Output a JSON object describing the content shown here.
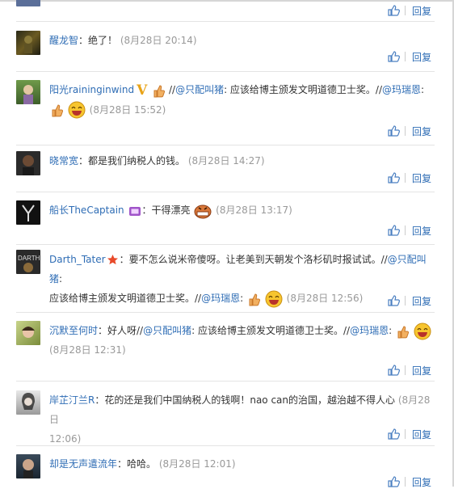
{
  "reply_label": "回复",
  "colors": {
    "link": "#2f6db5",
    "time": "#999999",
    "text": "#333333",
    "separator": "#e4e4e4"
  },
  "comments": [
    {
      "author": "醒龙智",
      "segments": [
        "：绝了！"
      ],
      "time": "(8月28日 20:14)"
    },
    {
      "author": "阳光raininginwind",
      "segments": [
        "//",
        "@只配叫猪",
        ": 应该给博主颁发文明道德卫士奖。//",
        "@玛瑞恩",
        ":"
      ],
      "time": "(8月28日 15:52)"
    },
    {
      "author": "晓常宽",
      "segments": [
        "：都是我们纳税人的钱。"
      ],
      "time": "(8月28日 14:27)"
    },
    {
      "author": "船长TheCaptain",
      "segments": [
        "：干得漂亮"
      ],
      "time": "(8月28日 13:17)"
    },
    {
      "author": "Darth_Tater",
      "segments": [
        "：要不怎么说米帝傻呀。让老美到天朝发个洛杉矶时报试试。//",
        "@只配叫猪",
        ":",
        "应该给博主颁发文明道德卫士奖。//",
        "@玛瑞恩",
        ":"
      ],
      "time": "(8月28日 12:56)"
    },
    {
      "author": "沉默至何时",
      "segments": [
        "：好人呀//",
        "@只配叫猪",
        ": 应该给博主颁发文明道德卫士奖。//",
        "@玛瑞恩",
        ":"
      ],
      "time": "(8月28日 12:31)"
    },
    {
      "author": "岸芷汀兰R",
      "segments": [
        "：花的还是我们中国纳税人的钱啊！nao can的治国，越治越不得人心"
      ],
      "time": "(8月28日",
      "time2": "12:06)"
    },
    {
      "author": "却是无声遣流年",
      "segments": [
        "：哈哈。"
      ],
      "time": "(8月28日 12:01)"
    }
  ]
}
